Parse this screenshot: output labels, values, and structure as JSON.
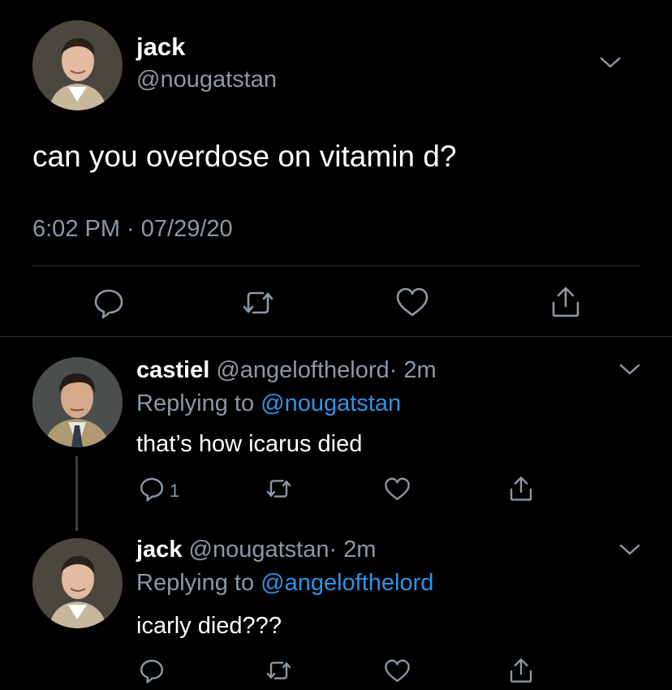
{
  "main_tweet": {
    "display_name": "jack",
    "handle": "@nougatstan",
    "text": "can you overdose on vitamin d?",
    "timestamp": "6:02 PM · 07/29/20",
    "actions": [
      "reply-icon",
      "retweet-icon",
      "like-icon",
      "share-icon"
    ]
  },
  "replies": [
    {
      "display_name": "castiel",
      "handle": "@angelofthelord",
      "time": "· 2m",
      "replying_prefix": "Replying to ",
      "replying_to": "@nougatstan",
      "text": "that’s how icarus died",
      "reply_count": "1"
    },
    {
      "display_name": "jack",
      "handle": "@nougatstan",
      "time": "· 2m",
      "replying_prefix": "Replying to ",
      "replying_to": "@angelofthelord",
      "text": "icarly died???",
      "reply_count": ""
    }
  ],
  "colors": {
    "background": "#000000",
    "text": "#ffffff",
    "muted": "#8b98a5",
    "link": "#2f93e6",
    "divider": "#2f3336"
  }
}
